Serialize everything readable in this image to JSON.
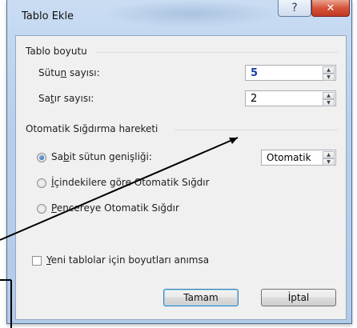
{
  "window": {
    "title": "Tablo Ekle",
    "help_label": "?",
    "close_label": "✕"
  },
  "table_size": {
    "group_label": "Tablo boyutu",
    "columns": {
      "label_pre": "Sütu",
      "label_u": "n",
      "label_post": " sayısı:",
      "value": "5"
    },
    "rows": {
      "label_pre": "Sa",
      "label_u": "t",
      "label_post": "ır sayısı:",
      "value": "2"
    }
  },
  "autofit": {
    "group_label": "Otomatik Sığdırma hareketi",
    "options": [
      {
        "pre": "Sa",
        "u": "b",
        "post": "it sütun genişliği:",
        "checked": true
      },
      {
        "pre": "",
        "u": "İ",
        "post": "çindekilere göre Otomatik Sığdır",
        "checked": false
      },
      {
        "pre": "",
        "u": "P",
        "post": "encereye Otomatik Sığdır",
        "checked": false
      }
    ],
    "fixed_width_value": "Otomatik"
  },
  "remember": {
    "pre": "",
    "u": "Y",
    "post": "eni tablolar için boyutları anımsa",
    "checked": false
  },
  "buttons": {
    "ok": "Tamam",
    "cancel": "İptal"
  },
  "icons": {
    "spin_up": "▲",
    "spin_down": "▼"
  }
}
